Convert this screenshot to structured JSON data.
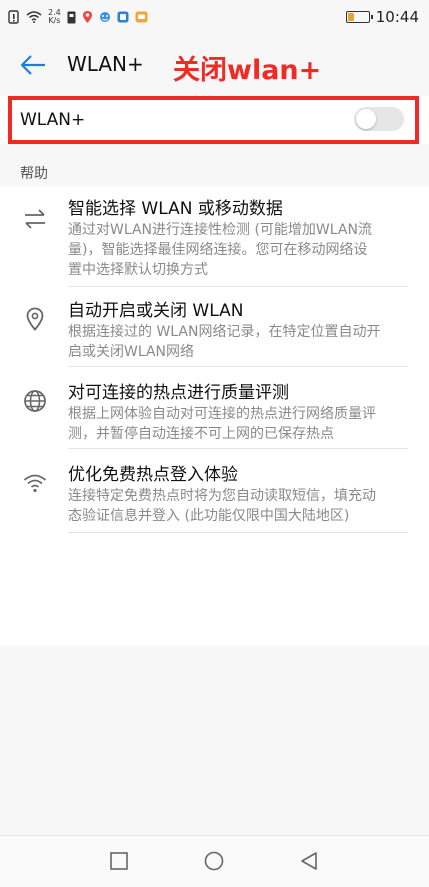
{
  "status_bar": {
    "speed_value": "2.4",
    "speed_unit": "K/s",
    "time": "10:44",
    "battery_level": 0.3,
    "battery_color": "#e7a23a",
    "icons": [
      "signal-icon",
      "wifi-icon",
      "speed-indicator",
      "sim-icon",
      "location-icon",
      "app-icon",
      "app-icon-2",
      "message-icon"
    ]
  },
  "header": {
    "title": "WLAN+",
    "annotation": "关闭wlan+",
    "annotation_color": "#ef2b24"
  },
  "wlan_toggle": {
    "label": "WLAN+",
    "state": "off"
  },
  "help": {
    "heading": "帮助",
    "items": [
      {
        "icon": "switch-arrows-icon",
        "title": "智能选择 WLAN 或移动数据",
        "lines": [
          "通过对WLAN进行连接性检测 (可能增加WLAN流",
          "量)，智能选择最佳网络连接。您可在移动网络设",
          "置中选择默认切换方式"
        ]
      },
      {
        "icon": "location-pin-icon",
        "title": "自动开启或关闭 WLAN",
        "lines": [
          "根据连接过的 WLAN网络记录，在特定位置自动开",
          "启或关闭WLAN网络"
        ]
      },
      {
        "icon": "globe-icon",
        "title": "对可连接的热点进行质量评测",
        "lines": [
          "根据上网体验自动对可连接的热点进行网络质量评",
          "测，并暂停自动连接不可上网的已保存热点"
        ]
      },
      {
        "icon": "wifi-icon",
        "title": "优化免费热点登入体验",
        "lines": [
          "连接特定免费热点时将为您自动读取短信，填充动",
          "态验证信息并登入 (此功能仅限中国大陆地区)"
        ]
      }
    ]
  },
  "nav_bar": {
    "buttons": [
      "recent-apps-icon",
      "home-icon",
      "back-icon"
    ]
  }
}
